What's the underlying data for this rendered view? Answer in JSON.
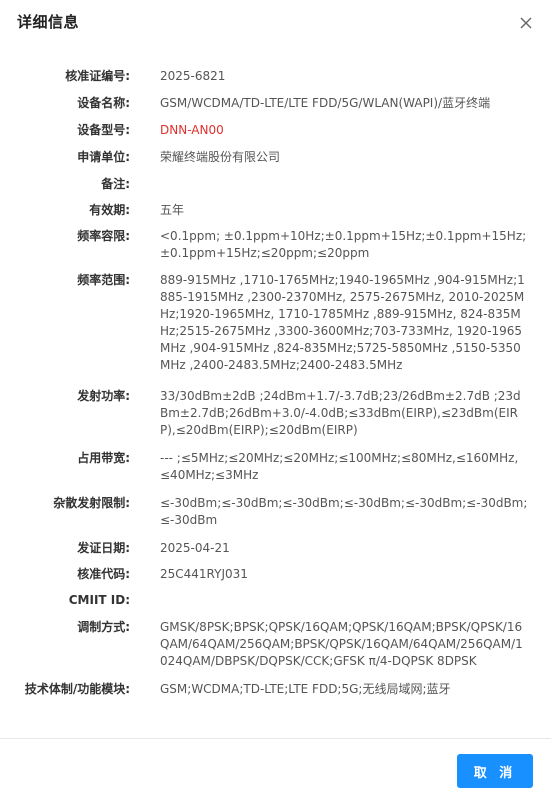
{
  "dialog": {
    "title": "详细信息",
    "cancel_label": "取 消"
  },
  "fields": [
    {
      "label": "核准证编号:",
      "value": "2025-6821"
    },
    {
      "label": "设备名称:",
      "value": "GSM/WCDMA/TD-LTE/LTE FDD/5G/WLAN(WAPI)/蓝牙终端"
    },
    {
      "label": "设备型号:",
      "value": "DNN-AN00"
    },
    {
      "label": "申请单位:",
      "value": "荣耀终端股份有限公司"
    },
    {
      "label": "备注:",
      "value": ""
    },
    {
      "label": "有效期:",
      "value": "五年"
    },
    {
      "label": "频率容限:",
      "value": " <0.1ppm; ±0.1ppm+10Hz;±0.1ppm+15Hz;±0.1ppm+15Hz;±0.1ppm+15Hz;≤20ppm;≤20ppm"
    },
    {
      "label": "频率范围:",
      "value": "889-915MHz ,1710-1765MHz;1940-1965MHz ,904-915MHz;1885-1915MHz ,2300-2370MHz, 2575-2675MHz, 2010-2025MHz;1920-1965MHz, 1710-1785MHz ,889-915MHz, 824-835MHz;2515-2675MHz ,3300-3600MHz;703-733MHz, 1920-1965MHz ,904-915MHz ,824-835MHz;5725-5850MHz ,5150-5350MHz ,2400-2483.5MHz;2400-2483.5MHz"
    },
    {
      "label": "发射功率:",
      "value": "33/30dBm±2dB ;24dBm+1.7/-3.7dB;23/26dBm±2.7dB ;23dBm±2.7dB;26dBm+3.0/-4.0dB;≤33dBm(EIRP),≤23dBm(EIRP),≤20dBm(EIRP);≤20dBm(EIRP)"
    },
    {
      "label": "占用带宽:",
      "value": "--- ;≤5MHz;≤20MHz;≤20MHz;≤100MHz;≤80MHz,≤160MHz,≤40MHz;≤3MHz"
    },
    {
      "label": "杂散发射限制:",
      "value": "≤-30dBm;≤-30dBm;≤-30dBm;≤-30dBm;≤-30dBm;≤-30dBm;≤-30dBm"
    },
    {
      "label": "发证日期:",
      "value": "2025-04-21"
    },
    {
      "label": "核准代码:",
      "value": "25C441RYJ031"
    },
    {
      "label": "CMIIT ID:",
      "value": ""
    },
    {
      "label": "调制方式:",
      "value": "GMSK/8PSK;BPSK;QPSK/16QAM;QPSK/16QAM;BPSK/QPSK/16QAM/64QAM/256QAM;BPSK/QPSK/16QAM/64QAM/256QAM/1024QAM/DBPSK/DQPSK/CCK;GFSK π/4-DQPSK 8DPSK"
    },
    {
      "label": "技术体制/功能模块:",
      "value": "GSM;WCDMA;TD-LTE;LTE FDD;5G;无线局域网;蓝牙"
    }
  ],
  "colors": {
    "accent": "#1890ff",
    "model_red": "#e0312f"
  }
}
